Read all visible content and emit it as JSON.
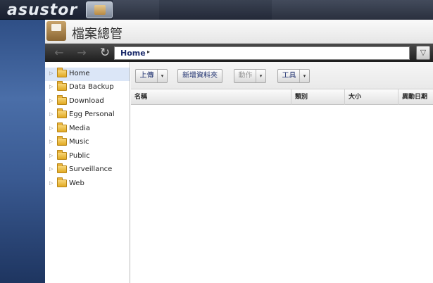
{
  "topbar": {
    "brand": "asustor",
    "app_icon": "file-explorer-icon"
  },
  "window": {
    "title": "檔案總管",
    "icon": "file-explorer-icon"
  },
  "nav": {
    "back_icon": "arrow-left-icon",
    "forward_icon": "arrow-right-icon",
    "refresh_icon": "refresh-icon",
    "path": "Home",
    "path_arrow": "▸",
    "filter_icon": "filter-icon"
  },
  "sidebar": {
    "items": [
      {
        "label": "Home",
        "selected": true
      },
      {
        "label": "Data Backup"
      },
      {
        "label": "Download"
      },
      {
        "label": "Egg Personal"
      },
      {
        "label": "Media"
      },
      {
        "label": "Music"
      },
      {
        "label": "Public"
      },
      {
        "label": "Surveillance"
      },
      {
        "label": "Web"
      }
    ]
  },
  "toolbar": {
    "upload": "上傳",
    "new_folder": "新增資料夾",
    "action": "動作",
    "tools": "工具"
  },
  "grid": {
    "columns": [
      "名稱",
      "類別",
      "大小",
      "異動日期"
    ]
  },
  "colors": {
    "accent": "#1c2b6b",
    "selected_row": "#dbe6f7",
    "folder": "#e1a922"
  }
}
